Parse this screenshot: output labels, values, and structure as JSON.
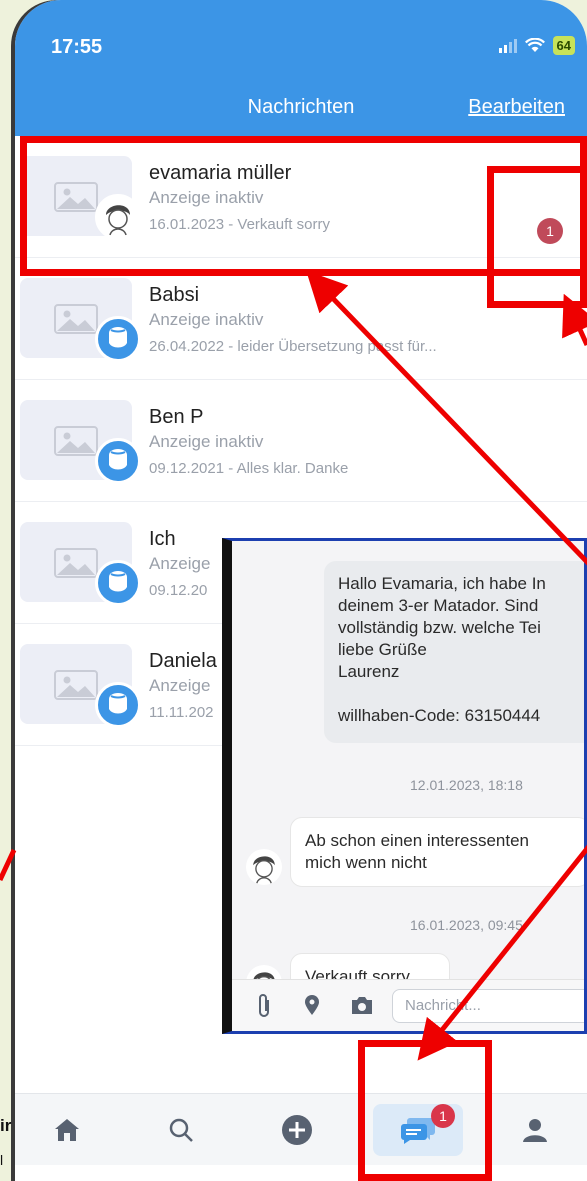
{
  "status": {
    "time": "17:55",
    "battery": "64"
  },
  "nav": {
    "title": "Nachrichten",
    "edit": "Bearbeiten"
  },
  "conversations": [
    {
      "name": "evamaria müller",
      "status": "Anzeige inaktiv",
      "preview": "16.01.2023 - Verkauft sorry",
      "unread": "1"
    },
    {
      "name": "Babsi",
      "status": "Anzeige inaktiv",
      "preview": "26.04.2022 - leider Übersetzung passt für..."
    },
    {
      "name": "Ben P",
      "status": "Anzeige inaktiv",
      "preview": "09.12.2021 - Alles klar. Danke"
    },
    {
      "name": "Ich",
      "status": "Anzeige",
      "preview": "09.12.20"
    },
    {
      "name": "Daniela",
      "status": "Anzeige",
      "preview": "11.11.202"
    }
  ],
  "chat": {
    "outgoing": "Hallo Evamaria, ich habe In\ndeinem 3-er Matador. Sind\nvollständig bzw. welche Tei\nliebe Grüße\nLaurenz\n\nwillhaben-Code: 63150444",
    "time1": "12.01.2023, 18:18",
    "incoming1": "Ab schon einen interessenten\nmich wenn nicht",
    "time2": "16.01.2023, 09:45",
    "incoming2": "Verkauft sorry",
    "input_placeholder": "Nachricht..."
  },
  "tabbar": {
    "messages_badge": "1"
  },
  "edge": {
    "text1": "ir",
    "text2": "l"
  },
  "colors": {
    "header": "#3c95e6",
    "annotation": "#ee0000",
    "badge": "#d9364a",
    "inset_border": "#1c3fb0"
  }
}
